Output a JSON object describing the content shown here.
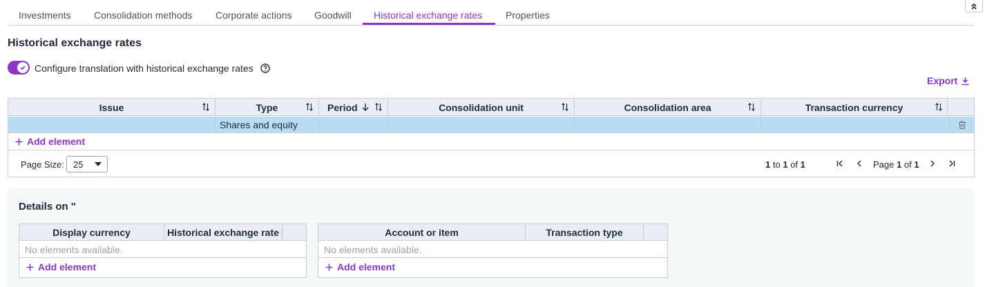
{
  "tabs": [
    {
      "label": "Investments"
    },
    {
      "label": "Consolidation methods"
    },
    {
      "label": "Corporate actions"
    },
    {
      "label": "Goodwill"
    },
    {
      "label": "Historical exchange rates"
    },
    {
      "label": "Properties"
    }
  ],
  "active_tab": "Historical exchange rates",
  "page_title": "Historical exchange rates",
  "toggle": {
    "label": "Configure translation with historical exchange rates",
    "on": true
  },
  "export_label": "Export",
  "grid": {
    "columns": [
      "Issue",
      "Type",
      "Period",
      "Consolidation unit",
      "Consolidation area",
      "Transaction currency"
    ],
    "rows": [
      {
        "issue": "",
        "type": "Shares and equity",
        "period": "",
        "consolidation_unit": "",
        "consolidation_area": "",
        "transaction_currency": ""
      }
    ],
    "add_element": "Add element",
    "page_size_label": "Page Size:",
    "page_size": "25",
    "range": {
      "from": "1",
      "to_word": "to",
      "to": "1",
      "of_word": "of",
      "total": "1"
    },
    "page": {
      "label": "Page",
      "current": "1",
      "of_word": "of",
      "total": "1"
    }
  },
  "details": {
    "title": "Details on ''",
    "left_grid": {
      "columns": [
        "Display currency",
        "Historical exchange rate"
      ],
      "empty": "No elements available.",
      "add_element": "Add element"
    },
    "right_grid": {
      "columns": [
        "Account or item",
        "Transaction type"
      ],
      "empty": "No elements available.",
      "add_element": "Add element"
    }
  },
  "colors": {
    "accent": "#8b35c9",
    "header_bg": "#e8eef4",
    "selected_row": "#b9dcf5",
    "details_bg": "#f4f8f8"
  }
}
